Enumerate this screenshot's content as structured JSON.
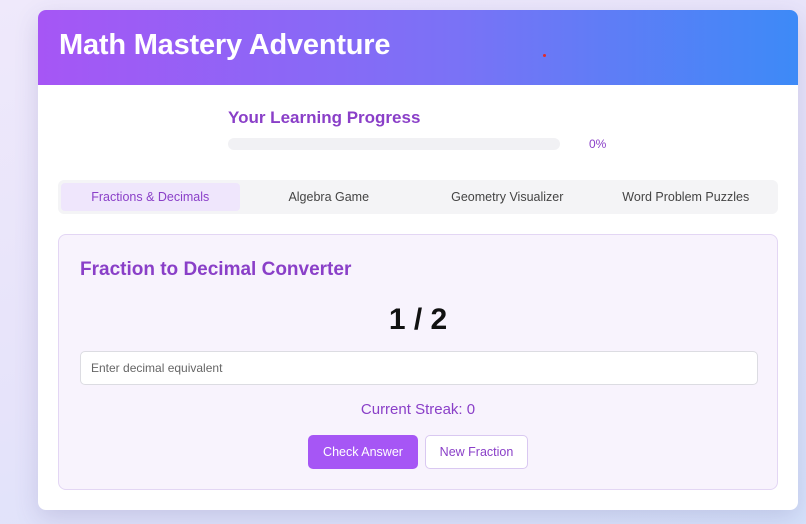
{
  "header": {
    "title": "Math Mastery Adventure"
  },
  "progress": {
    "title": "Your Learning Progress",
    "value": 0,
    "label": "0%"
  },
  "tabs": [
    {
      "label": "Fractions & Decimals",
      "active": true
    },
    {
      "label": "Algebra Game",
      "active": false
    },
    {
      "label": "Geometry Visualizer",
      "active": false
    },
    {
      "label": "Word Problem Puzzles",
      "active": false
    }
  ],
  "converter": {
    "title": "Fraction to Decimal Converter",
    "fraction": "1 / 2",
    "input_value": "",
    "input_placeholder": "Enter decimal equivalent",
    "streak": "Current Streak: 0",
    "check_label": "Check Answer",
    "new_label": "New Fraction"
  },
  "colors": {
    "accent": "#a656f5",
    "accent_text": "#8a3fc8",
    "header_end": "#3d8af7"
  }
}
